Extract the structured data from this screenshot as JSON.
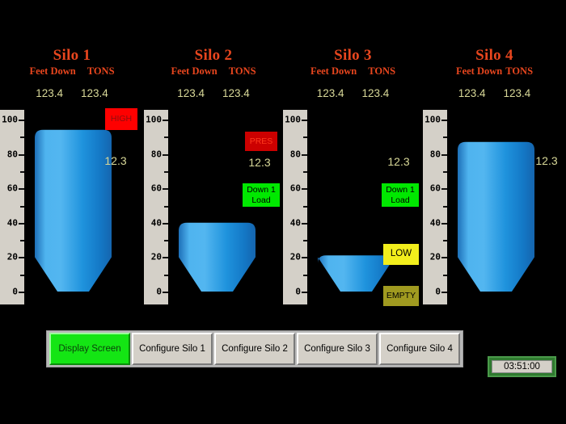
{
  "app": {
    "background_color": "#000000",
    "title_color": "#e8461e",
    "value_color": "#d8d898"
  },
  "scale": {
    "major_ticks": [
      0,
      20,
      40,
      60,
      80,
      100
    ],
    "minor_ticks": [
      10,
      30,
      50,
      70,
      90
    ],
    "min": 0,
    "max": 110,
    "labels": [
      "0",
      "20",
      "40",
      "60",
      "80",
      "100"
    ]
  },
  "silos": [
    {
      "title": "Silo 1",
      "label_feet": "Feet Down",
      "label_tons": "TONS",
      "feet_down": "123.4",
      "tons": "123.4",
      "side_value": "12.3",
      "level": 94,
      "fill_color": "#2e9fe0",
      "badges": [
        {
          "name": "high",
          "text": "HIGH",
          "class": "badge-high",
          "color": "#fe0000"
        }
      ]
    },
    {
      "title": "Silo 2",
      "label_feet": "Feet Down",
      "label_tons": "TONS",
      "feet_down": "123.4",
      "tons": "123.4",
      "side_value": "12.3",
      "level": 40,
      "fill_color": "#2e9fe0",
      "badges": [
        {
          "name": "pres",
          "text": "PRES",
          "class": "badge-pres",
          "color": "#cc0000"
        },
        {
          "name": "down-load",
          "text": "Down  1\nLoad",
          "class": "badge-down",
          "color": "#00e800"
        }
      ]
    },
    {
      "title": "Silo 3",
      "label_feet": "Feet Down",
      "label_tons": "TONS",
      "feet_down": "123.4",
      "tons": "123.4",
      "side_value": "12.3",
      "level": 21,
      "fill_color": "#2e9fe0",
      "badges": [
        {
          "name": "down-load",
          "text": "Down  1\nLoad",
          "class": "badge-down",
          "color": "#00e800"
        },
        {
          "name": "low",
          "text": "LOW",
          "class": "badge-low",
          "color": "#f2ee1c"
        },
        {
          "name": "empty",
          "text": "EMPTY",
          "class": "badge-empty",
          "color": "#a09a20"
        }
      ]
    },
    {
      "title": "Silo 4",
      "label_feet": "Feet Down",
      "label_tons": "TONS",
      "feet_down": "123.4",
      "tons": "123.4",
      "side_value": "12.3",
      "level": 87,
      "fill_color": "#2e9fe0",
      "badges": []
    }
  ],
  "nav": {
    "buttons": [
      {
        "label": "Display Screen",
        "active": true
      },
      {
        "label": "Configure Silo 1",
        "active": false
      },
      {
        "label": "Configure Silo 2",
        "active": false
      },
      {
        "label": "Configure Silo 3",
        "active": false
      },
      {
        "label": "Configure Silo 4",
        "active": false
      }
    ]
  },
  "clock": {
    "time": "03:51:00"
  }
}
